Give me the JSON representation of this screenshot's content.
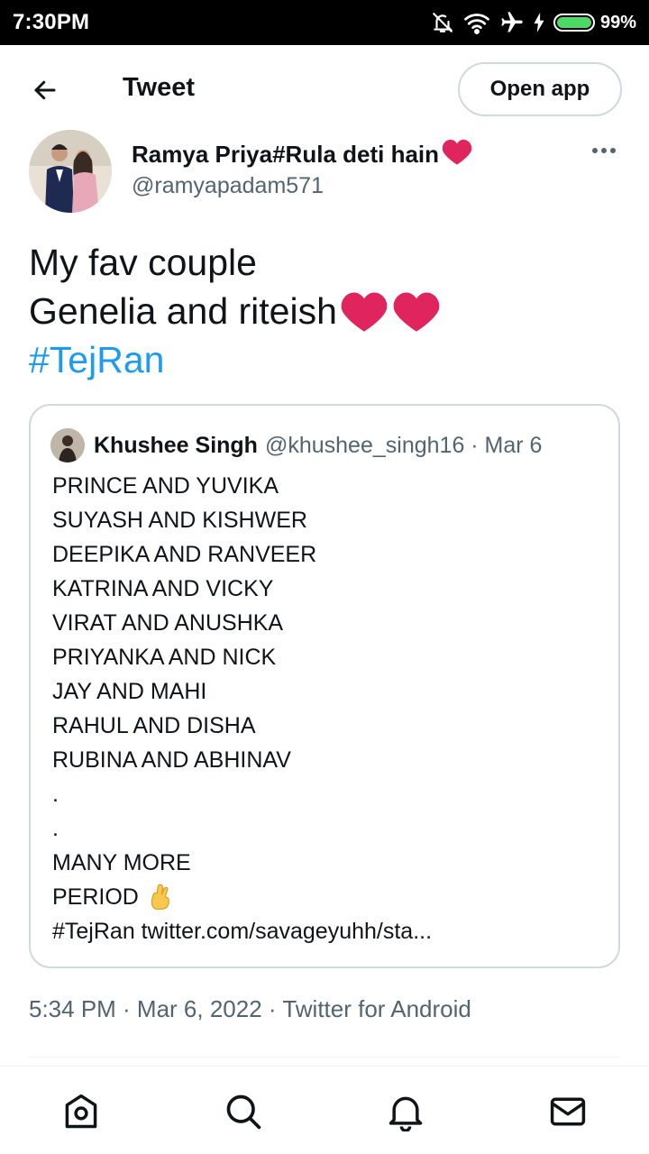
{
  "status_bar": {
    "time": "7:30PM",
    "battery": "99%",
    "battery_level": 0.99,
    "icons": [
      "bell-off-icon",
      "wifi-icon",
      "airplane-icon",
      "charging-icon",
      "battery-icon"
    ],
    "battery_color": "#4cd964"
  },
  "header": {
    "back_icon": "arrow-left-icon",
    "title": "Tweet",
    "open_app_label": "Open app"
  },
  "tweet": {
    "author_name": "Ramya Priya#Rula deti hain",
    "author_name_emoji": "❤️",
    "author_handle": "@ramyapadam571",
    "more_icon": "more-horizontal-icon",
    "text_line1": "My fav couple",
    "text_line2": "Genelia and riteish",
    "text_line2_emoji": "❤️❤️",
    "hashtag": "#TejRan",
    "hashtag_color": "#1d9bf0",
    "timestamp": "5:34 PM · Mar 6, 2022 · Twitter for Android"
  },
  "quoted_tweet": {
    "name": "Khushee Singh",
    "handle_date": "@khushee_singh16 · Mar 6",
    "lines": [
      "PRINCE AND YUVIKA",
      "SUYASH AND KISHWER",
      "DEEPIKA AND RANVEER",
      "KATRINA AND VICKY",
      "VIRAT AND ANUSHKA",
      "PRIYANKA AND NICK",
      "JAY AND MAHI",
      "RAHUL AND DISHA",
      "RUBINA AND ABHINAV",
      ".",
      ".",
      "MANY MORE"
    ],
    "period_text": "PERIOD",
    "period_emoji": "🤞",
    "last_line": "#TejRan twitter.com/savageyuhh/sta..."
  },
  "bottom_nav": {
    "icons": [
      "home-icon",
      "search-icon",
      "notifications-icon",
      "messages-icon"
    ]
  },
  "colors": {
    "text": "#0f1419",
    "secondary": "#536471",
    "border": "#cfd9de",
    "heart": "#e0245e"
  }
}
